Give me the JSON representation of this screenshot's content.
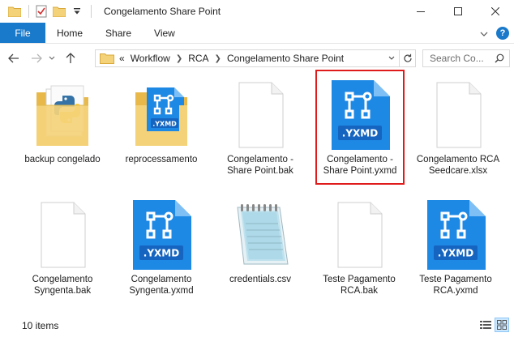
{
  "window": {
    "title": "Congelamento Share Point"
  },
  "ribbon": {
    "file_label": "File",
    "tabs": [
      "Home",
      "Share",
      "View"
    ]
  },
  "address": {
    "overflow": "«",
    "crumbs": [
      "Workflow",
      "RCA",
      "Congelamento Share Point"
    ]
  },
  "search": {
    "placeholder": "Search Co..."
  },
  "items": [
    {
      "label": "backup congelado",
      "icon": "python-folder-icon"
    },
    {
      "label": "reprocessamento",
      "icon": "yxmd-folder-icon"
    },
    {
      "label": "Congelamento - Share Point.bak",
      "icon": "blank-file-icon"
    },
    {
      "label": "Congelamento - Share Point.yxmd",
      "icon": "yxmd-file-icon",
      "selected": true,
      "badge": ".YXMD"
    },
    {
      "label": "Congelamento RCA Seedcare.xlsx",
      "icon": "blank-file-icon"
    },
    {
      "label": "Congelamento Syngenta.bak",
      "icon": "blank-file-icon"
    },
    {
      "label": "Congelamento Syngenta.yxmd",
      "icon": "yxmd-file-icon",
      "badge": ".YXMD"
    },
    {
      "label": "credentials.csv",
      "icon": "notepad-file-icon"
    },
    {
      "label": "Teste Pagamento RCA.bak",
      "icon": "blank-file-icon"
    },
    {
      "label": "Teste Pagamento RCA.yxmd",
      "icon": "yxmd-file-icon",
      "badge": ".YXMD"
    }
  ],
  "status": {
    "count": "10 items"
  },
  "colors": {
    "accent": "#1979ca",
    "yxmd_blue": "#1e88e5",
    "selection_border": "#e01b1b",
    "folder_yellow": "#f4d27a"
  }
}
